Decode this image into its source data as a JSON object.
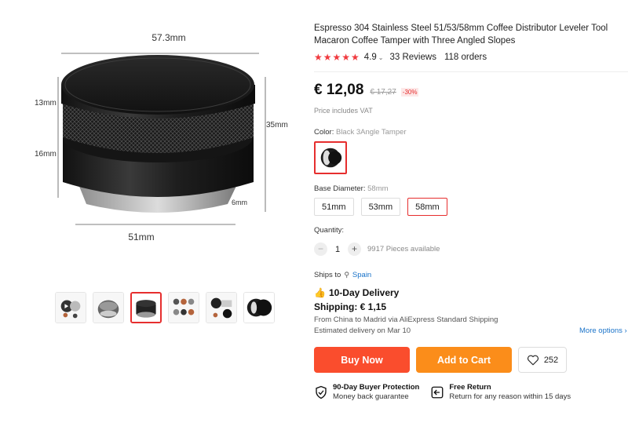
{
  "gallery": {
    "dimensions": {
      "top": "57.3mm",
      "upper": "13mm",
      "middle": "16mm",
      "height": "35mm",
      "base": "6mm",
      "bottom": "51mm"
    },
    "thumbnail_count": 6,
    "active_thumbnail": 3
  },
  "product": {
    "title": "Espresso 304 Stainless Steel 51/53/58mm Coffee Distributor Leveler Tool Macaron Coffee Tamper with Three Angled Slopes",
    "stars": "★★★★★",
    "rating": "4.9",
    "reviews": "33 Reviews",
    "orders": "118 orders"
  },
  "price": {
    "current": "€ 12,08",
    "original": "€ 17,27",
    "discount": "-30%",
    "vat_note": "Price includes VAT"
  },
  "color": {
    "label": "Color:",
    "selected": "Black 3Angle Tamper"
  },
  "base_diameter": {
    "label": "Base Diameter:",
    "selected": "58mm",
    "options": [
      "51mm",
      "53mm",
      "58mm"
    ]
  },
  "quantity": {
    "label": "Quantity:",
    "value": "1",
    "available": "9917 Pieces available"
  },
  "shipping": {
    "ships_to_label": "Ships to",
    "destination": "Spain",
    "delivery": "10-Day Delivery",
    "cost": "Shipping: € 1,15",
    "from": "From China to Madrid via AliExpress Standard Shipping",
    "estimated": "Estimated delivery on Mar 10",
    "more_options": "More options"
  },
  "actions": {
    "buy_now": "Buy Now",
    "add_to_cart": "Add to Cart",
    "wishlist_count": "252"
  },
  "guarantees": [
    {
      "title": "90-Day Buyer Protection",
      "subtitle": "Money back guarantee"
    },
    {
      "title": "Free Return",
      "subtitle": "Return for any reason within 15 days"
    }
  ],
  "colors": {
    "accent": "#e62e2e",
    "buy": "#fa4d2d",
    "cart": "#fb8d1a",
    "link": "#1a73c9",
    "stars": "#f0393e"
  }
}
